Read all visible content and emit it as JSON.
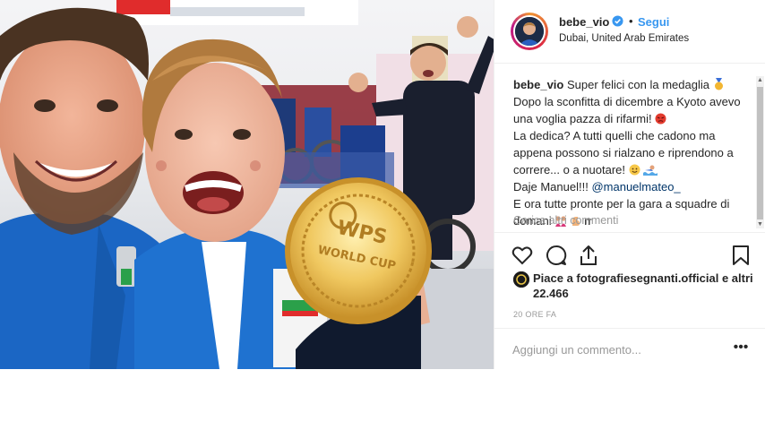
{
  "post": {
    "username": "bebe_vio",
    "follow_label": "Segui",
    "separator": "•",
    "location": "Dubai, United Arab Emirates",
    "caption": {
      "username": "bebe_vio",
      "line1": "Super felici con la medaglia",
      "line2": "Dopo la sconfitta di dicembre a Kyoto avevo una voglia pazza di rifarmi!",
      "line3": "La dedica? A tutti quelli che cadono ma appena possono si rialzano e riprendono a correre... o a nuotare!",
      "line4_prefix": "Daje Manuel!!!",
      "mention": "@manuelmateo_",
      "line5": "E ora tutte pronte per la gara a squadre di domani",
      "line5_suffix": "IT"
    },
    "load_more_comments": "Carica altri commenti",
    "likes_text": "Piace a fotografiesegnanti.official e altri 22.466",
    "timestamp": "20 ORE FA",
    "comment_placeholder": "Aggiungi un commento...",
    "more_options": "•••",
    "medal_text": "WORLD CUP"
  },
  "icons": {
    "verified": "verified-badge-icon",
    "like": "heart-icon",
    "comment": "comment-icon",
    "share": "share-icon",
    "save": "bookmark-icon",
    "medal_emoji": "medal-emoji",
    "angry_emoji": "angry-emoji",
    "smile_emoji": "smile-emoji",
    "wave_emoji": "swimmer-emoji",
    "family_emoji": "women-emoji",
    "muscle_emoji": "flexed-biceps-emoji",
    "flag_emoji": "italy-flag-emoji"
  },
  "colors": {
    "link_blue": "#3897f0",
    "mention_blue": "#003569",
    "text": "#262626",
    "muted": "#999999",
    "border": "#efefef"
  }
}
